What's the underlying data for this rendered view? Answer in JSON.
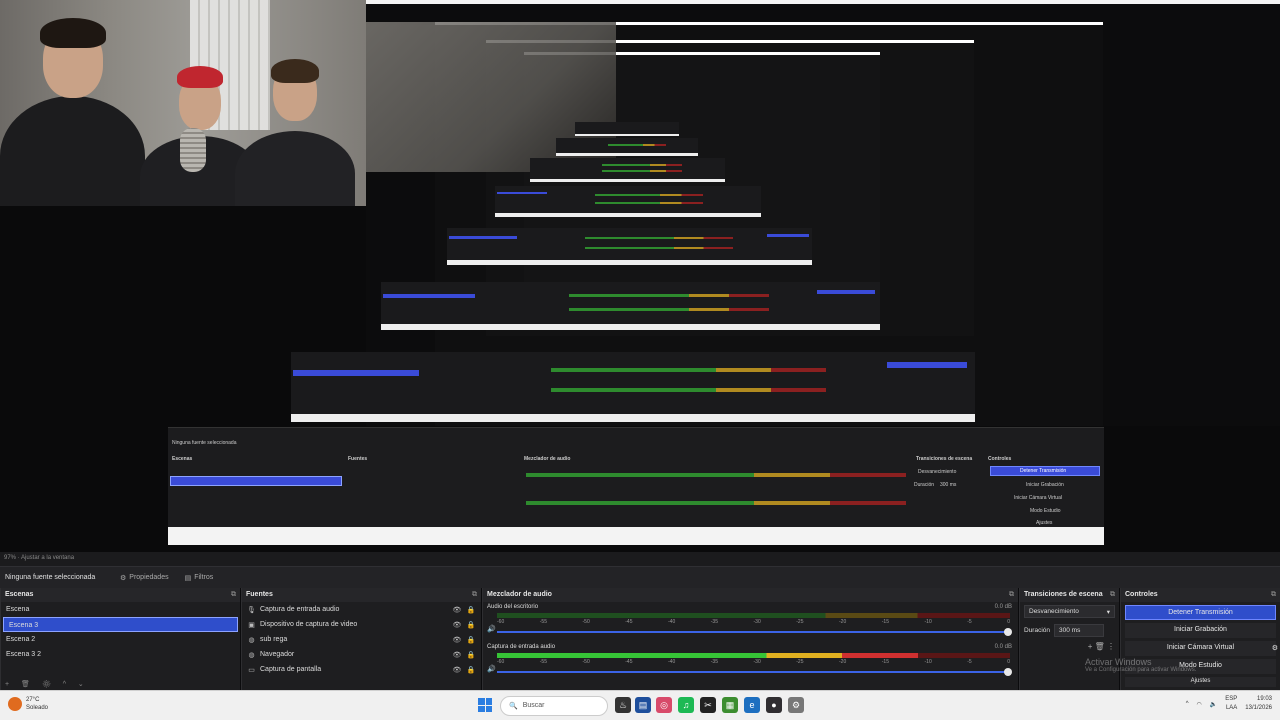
{
  "status_line": "97% · Ajustar a la ventana",
  "properties_bar": {
    "no_selection": "Ninguna fuente seleccionada",
    "properties_label": "Propiedades",
    "filters_label": "Filtros"
  },
  "scenes": {
    "title": "Escenas",
    "items": [
      "Escena",
      "Escena 3",
      "Escena 2",
      "Escena 3 2"
    ],
    "selected_index": 1
  },
  "sources": {
    "title": "Fuentes",
    "items": [
      {
        "name": "Captura de entrada audio",
        "icon": "microphone-icon"
      },
      {
        "name": "Dispositivo de captura de video",
        "icon": "camera-icon"
      },
      {
        "name": "sub rega",
        "icon": "globe-icon"
      },
      {
        "name": "Navegador",
        "icon": "globe-icon"
      },
      {
        "name": "Captura de pantalla",
        "icon": "monitor-icon"
      }
    ]
  },
  "mixer": {
    "title": "Mezclador de audio",
    "ticks": [
      "-60",
      "-55",
      "-50",
      "-45",
      "-40",
      "-35",
      "-30",
      "-25",
      "-20",
      "-15",
      "-10",
      "-5",
      "0"
    ],
    "channels": [
      {
        "name": "Audio del escritorio",
        "db": "0.0 dB",
        "level": 0.0
      },
      {
        "name": "Captura de entrada audio",
        "db": "0.0 dB",
        "level": 0.82
      }
    ]
  },
  "transitions": {
    "title": "Transiciones de escena",
    "selected": "Desvanecimiento",
    "duration_label": "Duración",
    "duration_value": "300 ms"
  },
  "controls": {
    "title": "Controles",
    "stop_stream": "Detener Transmisión",
    "start_recording": "Iniciar Grabación",
    "start_virtual_cam": "Iniciar Cámara Virtual",
    "studio_mode": "Modo Estudio",
    "settings": "Ajustes"
  },
  "watermark": {
    "title": "Activar Windows",
    "subtitle": "Ve a Configuración para activar Windows."
  },
  "taskbar": {
    "weather_temp": "27°C",
    "weather_desc": "Soleado",
    "search_placeholder": "Buscar",
    "lang_top": "ESP",
    "lang_bottom": "LAA",
    "time": "19:03",
    "date": "13/1/2026"
  },
  "inner": {
    "no_selection": "Ninguna fuente seleccionada",
    "scenes_title": "Escenas",
    "sources_title": "Fuentes",
    "mixer_title": "Mezclador de audio",
    "transitions_title": "Transiciones de escena",
    "controls_title": "Controles",
    "stop_stream": "Detener Transmisión",
    "start_recording": "Iniciar Grabación",
    "start_virtual_cam": "Iniciar Cámara Virtual",
    "studio_mode": "Modo Estudio",
    "settings": "Ajustes",
    "transition_selected": "Desvanecimiento",
    "duration_label": "Duración",
    "duration_value": "300 ms"
  }
}
